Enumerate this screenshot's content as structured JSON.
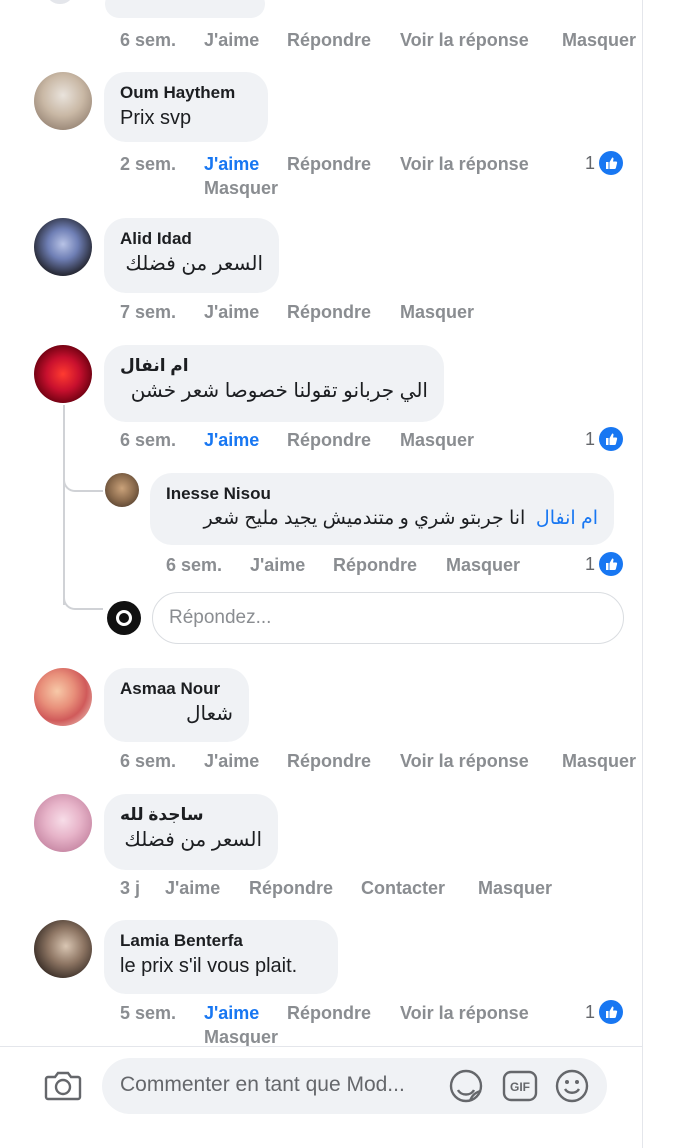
{
  "actions": {
    "like": "J'aime",
    "reply": "Répondre",
    "see_reply": "Voir la réponse",
    "hide": "Masquer",
    "contact": "Contacter"
  },
  "top_comment": {
    "time": "6 sem."
  },
  "comments": [
    {
      "author": "Oum Haythem",
      "text": "Prix svp",
      "time": "2 sem.",
      "reactions": "1"
    },
    {
      "author": "Alid Idad",
      "text": "السعر من فضلك",
      "time": "7 sem."
    },
    {
      "author": "ام انفال",
      "text": "الي جربانو تقولنا خصوصا شعر خشن",
      "time": "6 sem.",
      "reactions": "1"
    },
    {
      "author": "Asmaa Nour",
      "text": "شعال",
      "time": "6 sem."
    },
    {
      "author": "ساجدة لله",
      "text": "السعر من فضلك",
      "time": "3 j"
    },
    {
      "author": "Lamia Benterfa",
      "text": "le prix s'il vous plait.",
      "time": "5 sem.",
      "reactions": "1"
    }
  ],
  "reply": {
    "author": "Inesse Nisou",
    "mention": "ام انفال",
    "text": "انا جربتو شري و متندميش يجيد مليح شعر",
    "time": "6 sem.",
    "reactions": "1"
  },
  "reply_input": {
    "placeholder": "Répondez..."
  },
  "composer": {
    "placeholder": "Commenter en tant que Mod..."
  },
  "colors": {
    "like_blue": "#1877f2",
    "bubble": "#f0f2f5",
    "meta_gray": "#8a8d91"
  }
}
